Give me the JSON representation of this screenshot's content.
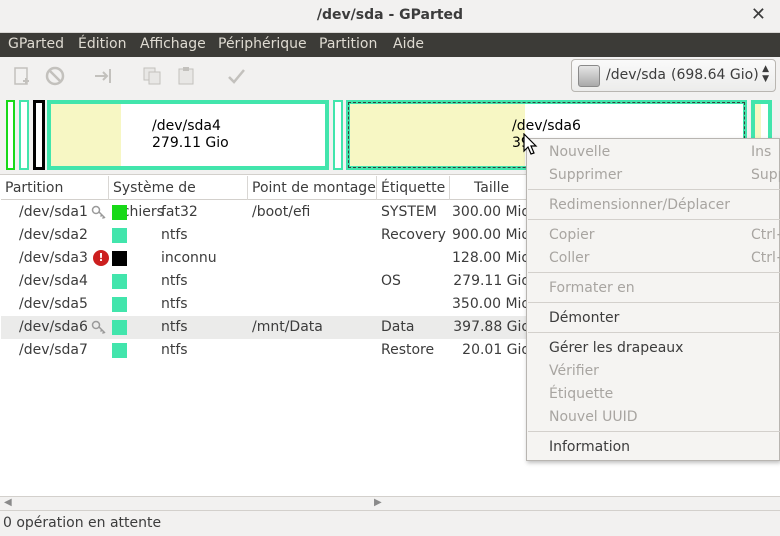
{
  "window": {
    "title": "/dev/sda - GParted"
  },
  "menubar": [
    "GParted",
    "Édition",
    "Affichage",
    "Périphérique",
    "Partition",
    "Aide"
  ],
  "toolbar": {
    "icons": [
      "new-partition-icon",
      "delete-icon",
      "resize-move-icon",
      "copy-icon",
      "paste-icon",
      "apply-icon"
    ],
    "device": "/dev/sda",
    "device_size": "(698.64 Gio)"
  },
  "disk_map": {
    "sda4": {
      "name": "/dev/sda4",
      "size": "279.11 Gio"
    },
    "sda6": {
      "name": "/dev/sda6",
      "size_partial": "39"
    }
  },
  "table": {
    "headers": [
      "Partition",
      "Système de fichiers",
      "Point de montage",
      "Étiquette",
      "Taille"
    ],
    "rows": [
      {
        "partition": "/dev/sda1",
        "fs": "fat32",
        "mount": "/boot/efi",
        "label": "SYSTEM",
        "size": "300.00 Mio",
        "fs_color": "#18d918",
        "mark": "key"
      },
      {
        "partition": "/dev/sda2",
        "fs": "ntfs",
        "mount": "",
        "label": "Recovery",
        "size": "900.00 Mio",
        "fs_color": "#42e5ac",
        "mark": ""
      },
      {
        "partition": "/dev/sda3",
        "fs": "inconnu",
        "mount": "",
        "label": "",
        "size": "128.00 Mio",
        "fs_color": "#000000",
        "mark": "warn"
      },
      {
        "partition": "/dev/sda4",
        "fs": "ntfs",
        "mount": "",
        "label": "OS",
        "size": "279.11 Gio",
        "fs_color": "#42e5ac",
        "mark": ""
      },
      {
        "partition": "/dev/sda5",
        "fs": "ntfs",
        "mount": "",
        "label": "",
        "size": "350.00 Mio",
        "fs_color": "#42e5ac",
        "mark": ""
      },
      {
        "partition": "/dev/sda6",
        "fs": "ntfs",
        "mount": "/mnt/Data",
        "label": "Data",
        "size": "397.88 Gio",
        "fs_color": "#42e5ac",
        "mark": "key",
        "selected": true
      },
      {
        "partition": "/dev/sda7",
        "fs": "ntfs",
        "mount": "",
        "label": "Restore",
        "size": "20.01 Gio",
        "fs_color": "#42e5ac",
        "mark": ""
      }
    ]
  },
  "context_menu": {
    "nouvelle": "Nouvelle",
    "nouvelle_acc": "Ins",
    "supprimer": "Supprimer",
    "supprimer_acc": "Supp",
    "redim": "Redimensionner/Déplacer",
    "copier": "Copier",
    "copier_acc": "Ctrl+",
    "coller": "Coller",
    "coller_acc": "Ctrl+",
    "formater": "Formater en",
    "demonter": "Démonter",
    "drapeaux": "Gérer les drapeaux",
    "verifier": "Vérifier",
    "etiquette": "Étiquette",
    "uuid": "Nouvel UUID",
    "information": "Information"
  },
  "status": {
    "text": "0 opération en attente"
  }
}
